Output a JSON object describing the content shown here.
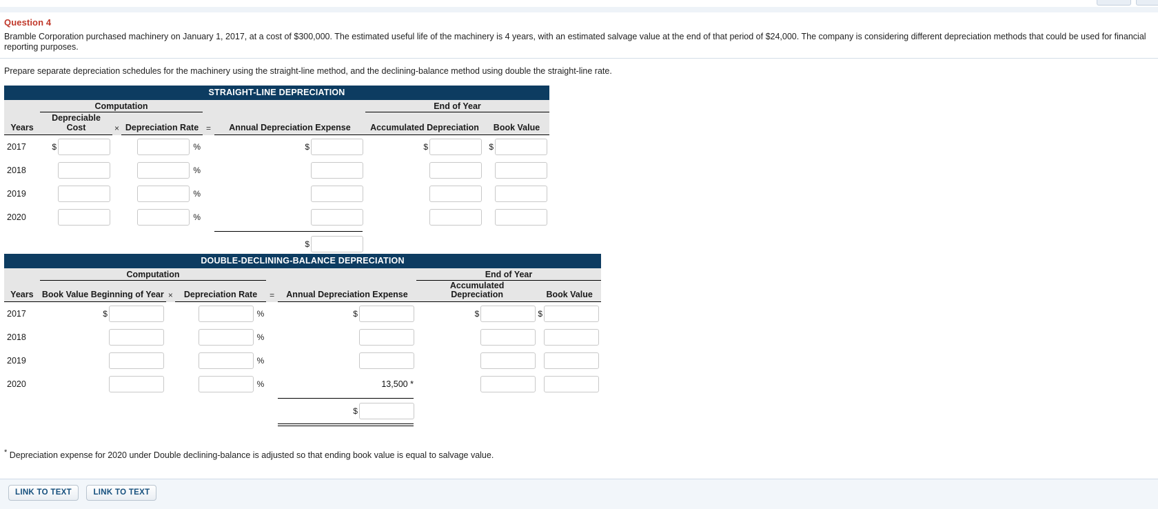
{
  "question": {
    "title": "Question 4",
    "body": "Bramble Corporation purchased machinery on January 1, 2017, at a cost of $300,000. The estimated useful life of the machinery is 4 years, with an estimated salvage value at the end of that period of $24,000. The company is considering different depreciation methods that could be used for financial reporting purposes.",
    "instruction": "Prepare separate depreciation schedules for the machinery using the straight-line method, and the declining-balance method using double the straight-line rate."
  },
  "symbols": {
    "dollar": "$",
    "percent": "%",
    "times": "×",
    "equals": "=",
    "asterisk": "*"
  },
  "colors": {
    "title_bar": "#0d3c61",
    "question_title": "#c0392b",
    "group_header_bg": "#e6e6e6",
    "button_text": "#16507e"
  },
  "straight_line": {
    "title": "STRAIGHT-LINE DEPRECIATION",
    "group_headers": {
      "years": "Years",
      "computation": "Computation",
      "end_of_year": "End of Year"
    },
    "columns": {
      "years": "Years",
      "depreciable_cost": "Depreciable Cost",
      "depreciation_rate": "Depreciation Rate",
      "annual_depreciation_expense": "Annual Depreciation Expense",
      "accumulated_depreciation": "Accumulated Depreciation",
      "book_value": "Book Value"
    },
    "rows": [
      {
        "year": "2017",
        "depreciable_cost": "",
        "depreciation_rate": "",
        "annual_expense": "",
        "accumulated_depreciation": "",
        "book_value": ""
      },
      {
        "year": "2018",
        "depreciable_cost": "",
        "depreciation_rate": "",
        "annual_expense": "",
        "accumulated_depreciation": "",
        "book_value": ""
      },
      {
        "year": "2019",
        "depreciable_cost": "",
        "depreciation_rate": "",
        "annual_expense": "",
        "accumulated_depreciation": "",
        "book_value": ""
      },
      {
        "year": "2020",
        "depreciable_cost": "",
        "depreciation_rate": "",
        "annual_expense": "",
        "accumulated_depreciation": "",
        "book_value": ""
      }
    ],
    "total": {
      "annual_expense": ""
    }
  },
  "double_declining": {
    "title": "DOUBLE-DECLINING-BALANCE DEPRECIATION",
    "group_headers": {
      "years": "Years",
      "computation": "Computation",
      "end_of_year": "End of Year"
    },
    "columns": {
      "years": "Years",
      "book_value_beginning": "Book Value Beginning of Year",
      "depreciation_rate": "Depreciation Rate",
      "annual_depreciation_expense": "Annual Depreciation Expense",
      "accumulated_depreciation_line1": "Accumulated",
      "accumulated_depreciation_line2": "Depreciation",
      "book_value": "Book Value"
    },
    "rows": [
      {
        "year": "2017",
        "book_value_beginning": "",
        "depreciation_rate": "",
        "annual_expense": "",
        "annual_expense_static": null,
        "accumulated_depreciation": "",
        "book_value": ""
      },
      {
        "year": "2018",
        "book_value_beginning": "",
        "depreciation_rate": "",
        "annual_expense": "",
        "annual_expense_static": null,
        "accumulated_depreciation": "",
        "book_value": ""
      },
      {
        "year": "2019",
        "book_value_beginning": "",
        "depreciation_rate": "",
        "annual_expense": "",
        "annual_expense_static": null,
        "accumulated_depreciation": "",
        "book_value": ""
      },
      {
        "year": "2020",
        "book_value_beginning": "",
        "depreciation_rate": "",
        "annual_expense": null,
        "annual_expense_static": "13,500 *",
        "accumulated_depreciation": "",
        "book_value": ""
      }
    ],
    "total": {
      "annual_expense": ""
    }
  },
  "footnote": {
    "marker": "*",
    "text": " Depreciation expense for 2020 under Double declining-balance is adjusted so that ending book value is equal to salvage value."
  },
  "bottom_bar": {
    "buttons": [
      {
        "label": "LINK TO TEXT"
      },
      {
        "label": "LINK TO TEXT"
      }
    ]
  }
}
